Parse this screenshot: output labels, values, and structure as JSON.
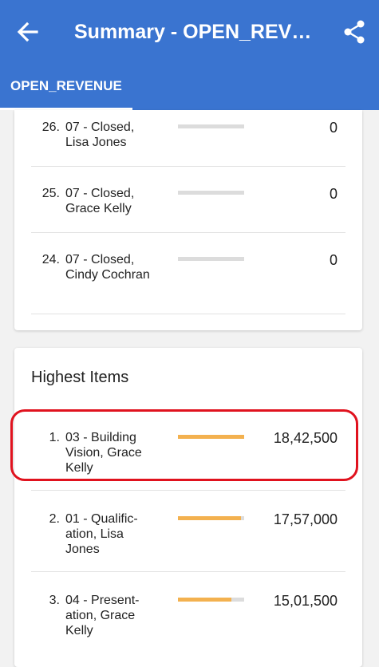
{
  "header": {
    "title": "Summary - OPEN_REVENUE",
    "tab_label": "OPEN_REVENUE",
    "icons": {
      "back": "back-arrow-icon",
      "share": "share-icon"
    }
  },
  "colors": {
    "appbar": "#3a74d0",
    "bar_fill": "#f3b14f",
    "bar_track": "#dcdcdc",
    "highlight": "#e0121e"
  },
  "lowest_items": [
    {
      "rank": "26.",
      "label": "07 - Closed, Lisa Jones",
      "value": "0",
      "fraction": 0
    },
    {
      "rank": "25.",
      "label": "07 - Closed, Grace Kelly",
      "value": "0",
      "fraction": 0
    },
    {
      "rank": "24.",
      "label": "07 - Closed, Cindy Cochran",
      "value": "0",
      "fraction": 0
    }
  ],
  "highest": {
    "title": "Highest Items",
    "items": [
      {
        "rank": "1.",
        "label": "03 - Building Vision, Grace Kelly",
        "value": "18,42,500",
        "fraction": 1.0
      },
      {
        "rank": "2.",
        "label": "01 - Qualific-ation, Lisa Jones",
        "value": "17,57,000",
        "fraction": 0.95
      },
      {
        "rank": "3.",
        "label": "04 - Present-ation, Grace Kelly",
        "value": "15,01,500",
        "fraction": 0.81
      }
    ]
  }
}
